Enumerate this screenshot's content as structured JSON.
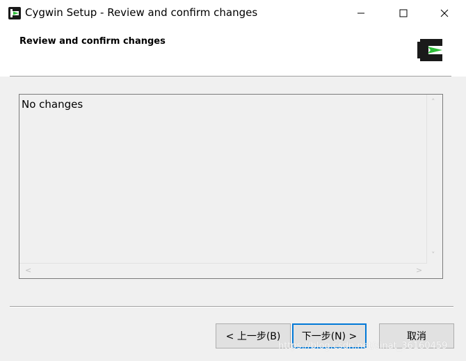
{
  "window": {
    "title": "Cygwin Setup - Review and confirm changes",
    "controls": {
      "minimize": "—",
      "maximize": "☐",
      "close": "✕"
    }
  },
  "header": {
    "title": "Review and confirm changes",
    "logo_icon": "cygwin-logo-icon"
  },
  "changes_list": {
    "content": "No changes",
    "scroll_up": "˄",
    "scroll_down": "˅",
    "scroll_left": "<",
    "scroll_right": ">"
  },
  "buttons": {
    "back": "< 上一步(B)",
    "next": "下一步(N) >",
    "cancel": "取消"
  },
  "watermark": "https://blog.csdn.net/sinat_36160459",
  "colors": {
    "logo_green": "#2fbf3a",
    "logo_black": "#1a1a1a",
    "default_button_border": "#0078d7"
  }
}
